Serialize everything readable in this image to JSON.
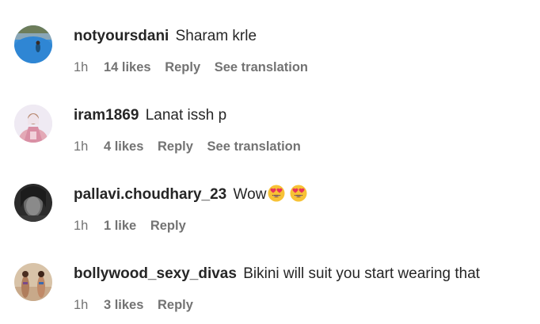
{
  "comments": [
    {
      "username": "notyoursdani",
      "text": "Sharam krle",
      "time": "1h",
      "likes": "14 likes",
      "reply": "Reply",
      "translation": "See translation",
      "avatar": "pool-photo-avatar"
    },
    {
      "username": "iram1869",
      "text": "Lanat issh p",
      "time": "1h",
      "likes": "4 likes",
      "reply": "Reply",
      "translation": "See translation",
      "avatar": "woman-portrait-avatar"
    },
    {
      "username": "pallavi.choudhary_23",
      "text": "Wow",
      "emojis": [
        "heart-eyes-emoji",
        "heart-eyes-emoji"
      ],
      "time": "1h",
      "likes": "1 like",
      "reply": "Reply",
      "avatar": "dark-portrait-avatar"
    },
    {
      "username": "bollywood_sexy_divas",
      "text": "Bikini will suit you start wearing that",
      "time": "1h",
      "likes": "3 likes",
      "reply": "Reply",
      "avatar": "beach-photo-avatar"
    }
  ],
  "colors": {
    "primary_text": "#262626",
    "secondary_text": "#737373",
    "background": "#ffffff"
  }
}
